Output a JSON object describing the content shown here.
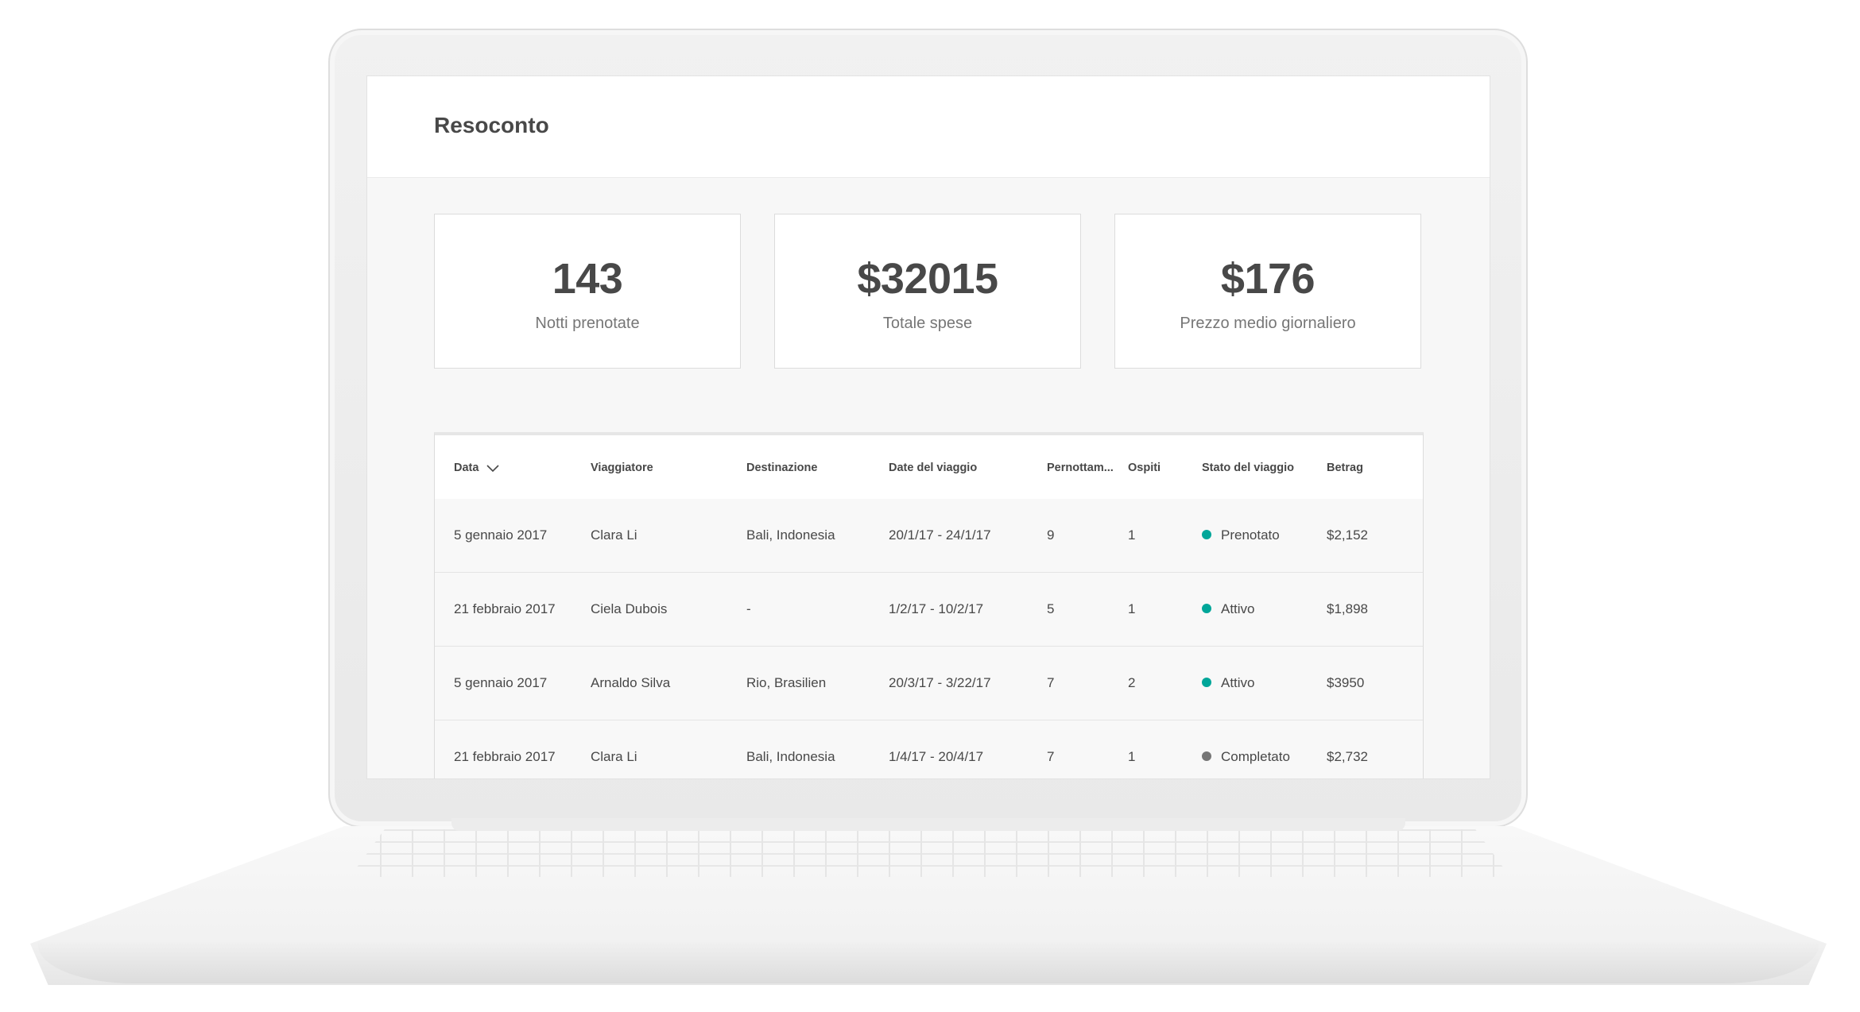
{
  "page": {
    "title": "Resoconto"
  },
  "stats": [
    {
      "value": "143",
      "label": "Notti prenotate"
    },
    {
      "value": "$32015",
      "label": "Totale spese"
    },
    {
      "value": "$176",
      "label": "Prezzo medio giornaliero"
    }
  ],
  "table": {
    "headers": {
      "date": "Data",
      "traveler": "Viaggiatore",
      "destination": "Destinazione",
      "trip_dates": "Date del viaggio",
      "nights": "Pernottam...",
      "guests": "Ospiti",
      "status": "Stato del viaggio",
      "amount": "Betrag"
    },
    "sort_icon": "chevron-down-icon",
    "rows": [
      {
        "date": "5 gennaio 2017",
        "traveler": "Clara Li",
        "destination": "Bali, Indonesia",
        "trip_dates": "20/1/17 - 24/1/17",
        "nights": "9",
        "guests": "1",
        "status": "Prenotato",
        "status_color": "#00a699",
        "amount": "$2,152"
      },
      {
        "date": "21 febbraio 2017",
        "traveler": "Ciela Dubois",
        "destination": "-",
        "trip_dates": "1/2/17 - 10/2/17",
        "nights": "5",
        "guests": "1",
        "status": "Attivo",
        "status_color": "#00a699",
        "amount": "$1,898"
      },
      {
        "date": "5 gennaio 2017",
        "traveler": "Arnaldo Silva",
        "destination": "Rio, Brasilien",
        "trip_dates": "20/3/17 - 3/22/17",
        "nights": "7",
        "guests": "2",
        "status": "Attivo",
        "status_color": "#00a699",
        "amount": "$3950"
      },
      {
        "date": "21 febbraio 2017",
        "traveler": "Clara Li",
        "destination": "Bali, Indonesia",
        "trip_dates": "1/4/17 - 20/4/17",
        "nights": "7",
        "guests": "1",
        "status": "Completato",
        "status_color": "#767676",
        "amount": "$2,732"
      }
    ]
  }
}
